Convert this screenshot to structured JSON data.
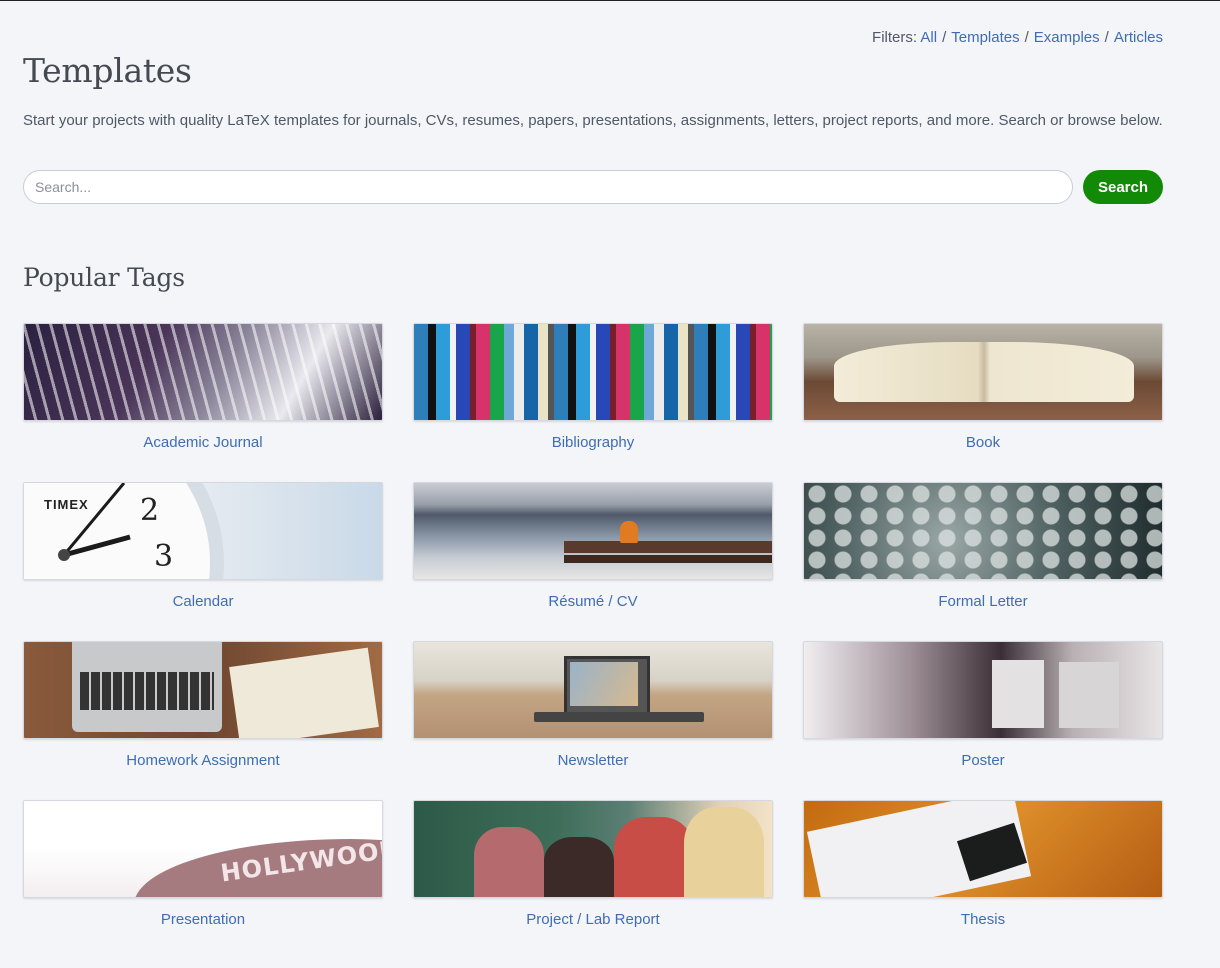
{
  "filters": {
    "prefix": "Filters:",
    "items": [
      "All",
      "Templates",
      "Examples",
      "Articles"
    ],
    "separator": "/"
  },
  "page": {
    "title": "Templates",
    "intro": "Start your projects with quality LaTeX templates for journals, CVs, resumes, papers, presentations, assignments, letters, project reports, and more. Search or browse below."
  },
  "search": {
    "placeholder": "Search...",
    "button_label": "Search",
    "button_color": "#138a07"
  },
  "popular_tags": {
    "heading": "Popular Tags",
    "tags": [
      {
        "label": "Academic Journal"
      },
      {
        "label": "Bibliography"
      },
      {
        "label": "Book"
      },
      {
        "label": "Calendar",
        "thumb_text": {
          "brand": "TIMEX",
          "numeral_top": "2",
          "numeral_bottom": "3"
        }
      },
      {
        "label": "Résumé / CV"
      },
      {
        "label": "Formal Letter"
      },
      {
        "label": "Homework Assignment"
      },
      {
        "label": "Newsletter"
      },
      {
        "label": "Poster"
      },
      {
        "label": "Presentation",
        "thumb_text": {
          "sign": "HOLLYWOOD"
        }
      },
      {
        "label": "Project / Lab Report"
      },
      {
        "label": "Thesis"
      }
    ]
  },
  "colors": {
    "link": "#3e6db4",
    "background": "#f4f5f8",
    "heading": "#454a52"
  }
}
